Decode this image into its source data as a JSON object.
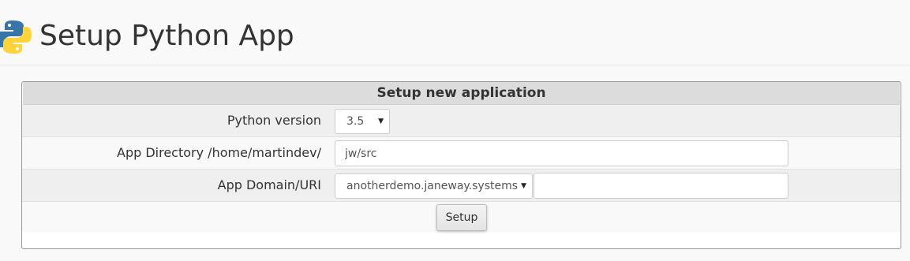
{
  "header": {
    "title": "Setup Python App",
    "logo_icon": "python-logo-icon"
  },
  "panel": {
    "title": "Setup new application",
    "python_version": {
      "label": "Python version",
      "selected": "3.5"
    },
    "app_directory": {
      "label": "App Directory /home/martindev/",
      "value": "jw/src"
    },
    "app_domain": {
      "label": "App Domain/URI",
      "selected_domain": "anotherdemo.janeway.systems",
      "uri_value": ""
    },
    "setup_button_label": "Setup"
  },
  "colors": {
    "python_blue": "#3775a9",
    "python_yellow": "#ffd43b",
    "panel_title_bg": "#dcdcdc",
    "row_shaded_bg": "#efefef"
  }
}
